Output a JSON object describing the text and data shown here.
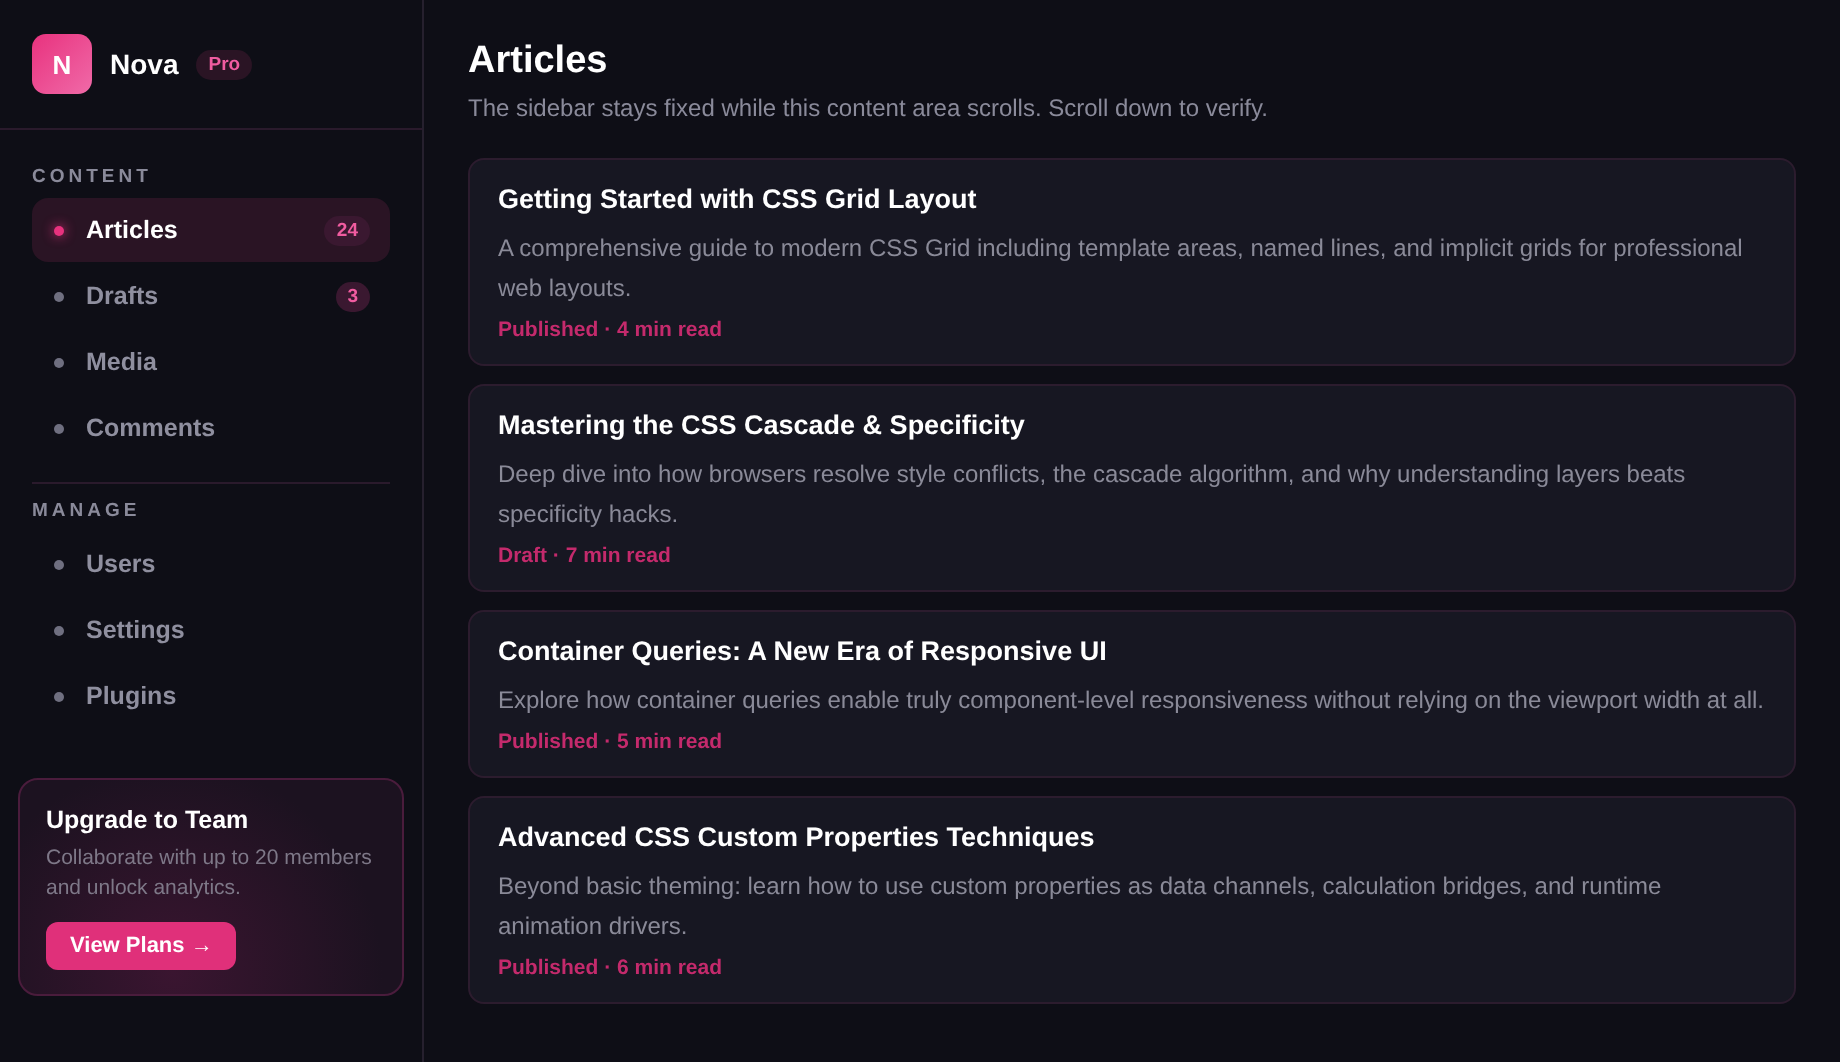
{
  "brand": {
    "logo_letter": "N",
    "name": "Nova",
    "badge": "Pro"
  },
  "sidebar": {
    "sections": [
      {
        "label": "CONTENT",
        "items": [
          {
            "label": "Articles",
            "selected": true,
            "count": "24"
          },
          {
            "label": "Drafts",
            "selected": false,
            "count": "3"
          },
          {
            "label": "Media",
            "selected": false
          },
          {
            "label": "Comments",
            "selected": false
          }
        ]
      },
      {
        "label": "MANAGE",
        "items": [
          {
            "label": "Users",
            "selected": false
          },
          {
            "label": "Settings",
            "selected": false
          },
          {
            "label": "Plugins",
            "selected": false
          }
        ]
      }
    ]
  },
  "upgrade": {
    "title": "Upgrade to Team",
    "text": "Collaborate with up to 20 members and unlock analytics.",
    "button": "View Plans →"
  },
  "page": {
    "title": "Articles",
    "subtitle": "The sidebar stays fixed while this content area scrolls. Scroll down to verify."
  },
  "articles": [
    {
      "title": "Getting Started with CSS Grid Layout",
      "description": "A comprehensive guide to modern CSS Grid including template areas, named lines, and implicit grids for professional web layouts.",
      "meta": "Published · 4 min read"
    },
    {
      "title": "Mastering the CSS Cascade & Specificity",
      "description": "Deep dive into how browsers resolve style conflicts, the cascade algorithm, and why understanding layers beats specificity hacks.",
      "meta": "Draft · 7 min read"
    },
    {
      "title": "Container Queries: A New Era of Responsive UI",
      "description": "Explore how container queries enable truly component-level responsiveness without relying on the viewport width at all.",
      "meta": "Published · 5 min read"
    },
    {
      "title": "Advanced CSS Custom Properties Techniques",
      "description": "Beyond basic theming: learn how to use custom properties as data channels, calculation bridges, and runtime animation drivers.",
      "meta": "Published · 6 min read"
    }
  ]
}
